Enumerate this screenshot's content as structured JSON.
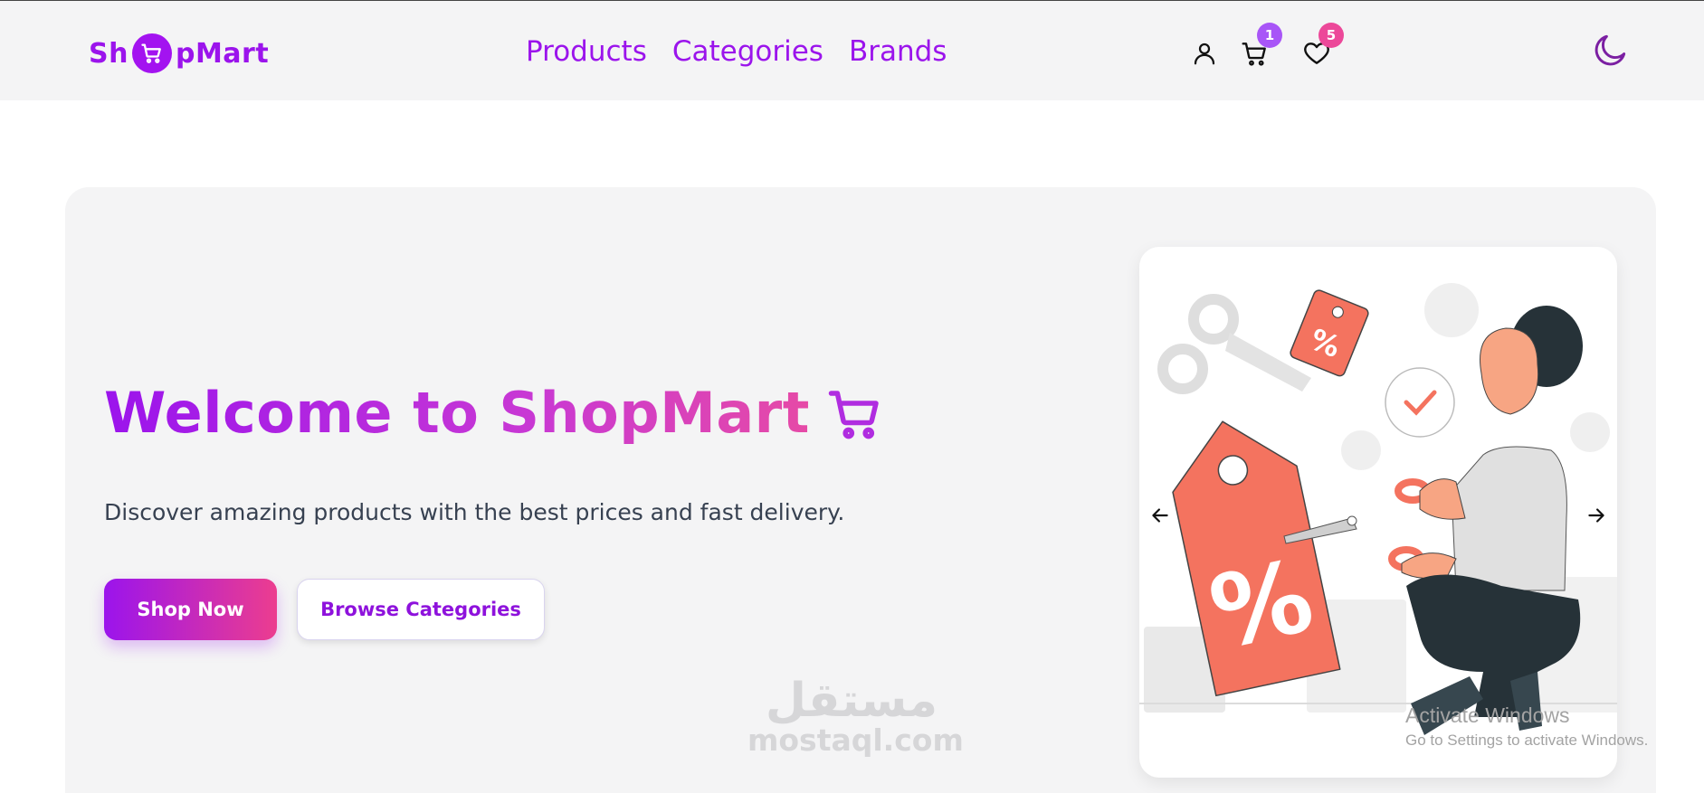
{
  "logo": {
    "text_before": "Sh",
    "text_after": "pMart"
  },
  "nav": {
    "links": [
      {
        "label": "Products"
      },
      {
        "label": "Categories"
      },
      {
        "label": "Brands"
      }
    ],
    "cart_count": "1",
    "wishlist_count": "5"
  },
  "hero": {
    "title": "Welcome to ShopMart",
    "subtitle": "Discover amazing products with the best prices and fast delivery.",
    "primary_button": "Shop Now",
    "secondary_button": "Browse Categories"
  },
  "watermark": {
    "arabic": "مستقل",
    "latin": "mostaql.com"
  },
  "os_overlay": {
    "title": "Activate Windows",
    "subtitle": "Go to Settings to activate Windows."
  },
  "colors": {
    "brand_purple": "#9b14ec",
    "brand_pink": "#ec3d8f",
    "tag_coral": "#f4735f",
    "cart_badge": "#a855f7",
    "wishlist_badge": "#ec4899"
  },
  "icons": [
    "cart-icon",
    "user-icon",
    "heart-icon",
    "moon-icon",
    "arrow-left-icon",
    "arrow-right-icon"
  ]
}
